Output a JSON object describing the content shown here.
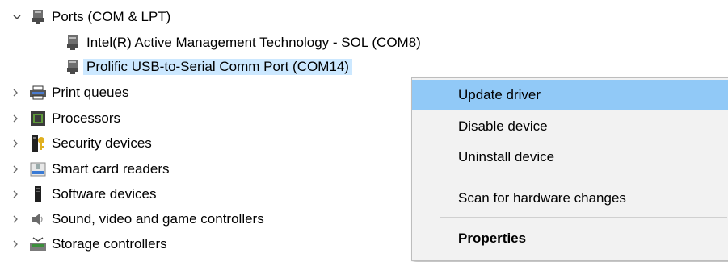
{
  "tree": {
    "ports": {
      "label": "Ports (COM & LPT)",
      "children": [
        "Intel(R) Active Management Technology - SOL (COM8)",
        "Prolific USB-to-Serial Comm Port (COM14)"
      ]
    },
    "categories": [
      {
        "label": "Print queues",
        "icon": "printer-icon"
      },
      {
        "label": "Processors",
        "icon": "processor-icon"
      },
      {
        "label": "Security devices",
        "icon": "security-device-icon"
      },
      {
        "label": "Smart card readers",
        "icon": "smart-card-reader-icon"
      },
      {
        "label": "Software devices",
        "icon": "software-device-icon"
      },
      {
        "label": "Sound, video and game controllers",
        "icon": "speaker-icon"
      },
      {
        "label": "Storage controllers",
        "icon": "storage-controller-icon"
      }
    ]
  },
  "context_menu": {
    "items": [
      "Update driver",
      "Disable device",
      "Uninstall device",
      "Scan for hardware changes",
      "Properties"
    ]
  },
  "colors": {
    "menu_highlight": "#91c9f7",
    "selected_row": "#cce8ff",
    "menu_background": "#f2f2f2"
  }
}
